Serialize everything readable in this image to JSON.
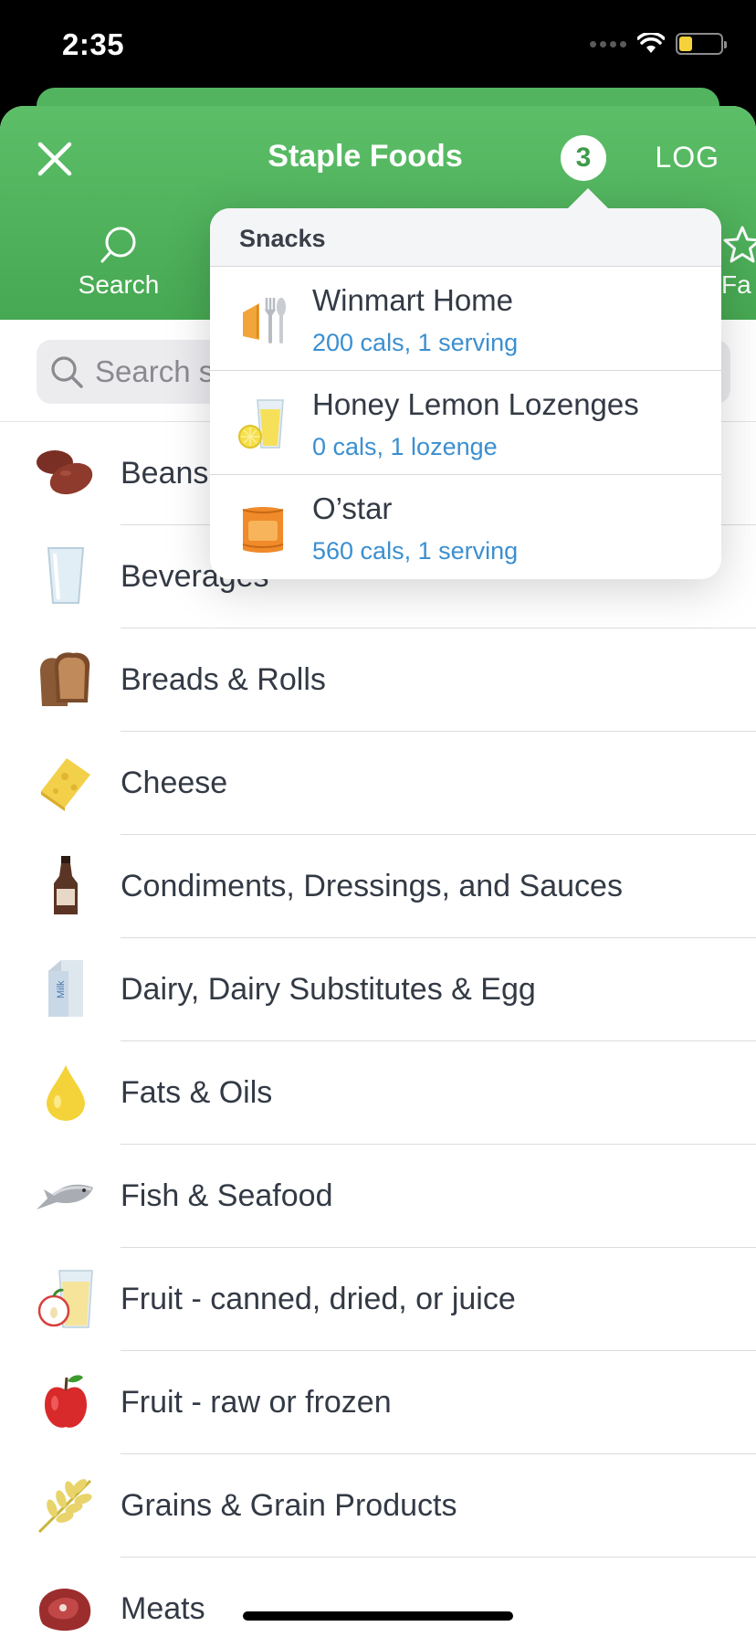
{
  "status_bar": {
    "time": "2:35"
  },
  "header": {
    "title": "Staple Foods",
    "badge_count": "3",
    "log_label": "LOG",
    "tabs": [
      {
        "label": "Search",
        "icon": "search-icon"
      },
      {
        "label": "Fa",
        "icon": "star-icon"
      }
    ]
  },
  "search": {
    "placeholder": "Search s"
  },
  "categories": [
    {
      "label": "Beans",
      "icon": "beans-icon"
    },
    {
      "label": "Beverages",
      "icon": "glass-icon"
    },
    {
      "label": "Breads & Rolls",
      "icon": "bread-icon"
    },
    {
      "label": "Cheese",
      "icon": "cheese-icon"
    },
    {
      "label": "Condiments, Dressings, and Sauces",
      "icon": "sauce-bottle-icon"
    },
    {
      "label": "Dairy, Dairy Substitutes & Egg",
      "icon": "milk-carton-icon"
    },
    {
      "label": "Fats & Oils",
      "icon": "oil-drop-icon"
    },
    {
      "label": "Fish & Seafood",
      "icon": "fish-icon"
    },
    {
      "label": "Fruit - canned, dried, or juice",
      "icon": "fruit-juice-icon"
    },
    {
      "label": "Fruit - raw or frozen",
      "icon": "apple-icon"
    },
    {
      "label": "Grains & Grain Products",
      "icon": "wheat-icon"
    },
    {
      "label": "Meats",
      "icon": "meat-icon"
    }
  ],
  "popover": {
    "section_title": "Snacks",
    "items": [
      {
        "name": "Winmart Home",
        "detail": "200 cals, 1 serving",
        "icon": "utensils-icon"
      },
      {
        "name": "Honey Lemon Lozenges",
        "detail": "0 cals, 1 lozenge",
        "icon": "lemon-juice-icon"
      },
      {
        "name": "O’star",
        "detail": "560 cals, 1 serving",
        "icon": "snack-box-icon"
      }
    ]
  },
  "colors": {
    "header_green": "#4fb35b",
    "link_blue": "#3b8fd0",
    "text_dark": "#333a45"
  }
}
